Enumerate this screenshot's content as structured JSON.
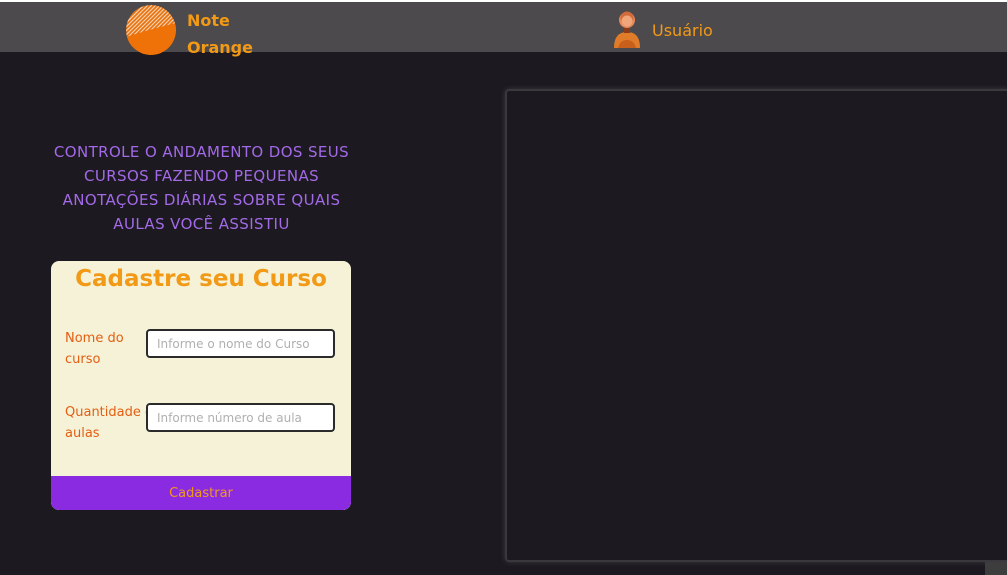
{
  "header": {
    "brand_line1": "Note",
    "brand_line2": "Orange",
    "user_label": "Usuário"
  },
  "tagline": "CONTROLE O ANDAMENTO DOS SEUS CURSOS FAZENDO PEQUENAS ANOTAÇÕES DIÁRIAS SOBRE QUAIS AULAS VOCÊ ASSISTIU",
  "form": {
    "title": "Cadastre seu Curso",
    "course_name_label": "Nome do curso",
    "course_name_value": "",
    "course_name_placeholder": "Informe o nome do Curso",
    "lessons_label": "Quantidade de aulas",
    "lessons_value": "",
    "lessons_placeholder": "Informe número de aula",
    "submit_label": "Cadastrar"
  },
  "colors": {
    "accent_orange": "#f29a16",
    "label_orange": "#e45e12",
    "purple": "#8a2be2",
    "tagline_purple": "#a36ae8",
    "background": "#1c1920",
    "header_bg": "#4c4a4d",
    "card_bg": "#f5f2d8"
  },
  "icons": {
    "logo": "orange-note-logo-icon",
    "user": "user-avatar-icon"
  }
}
